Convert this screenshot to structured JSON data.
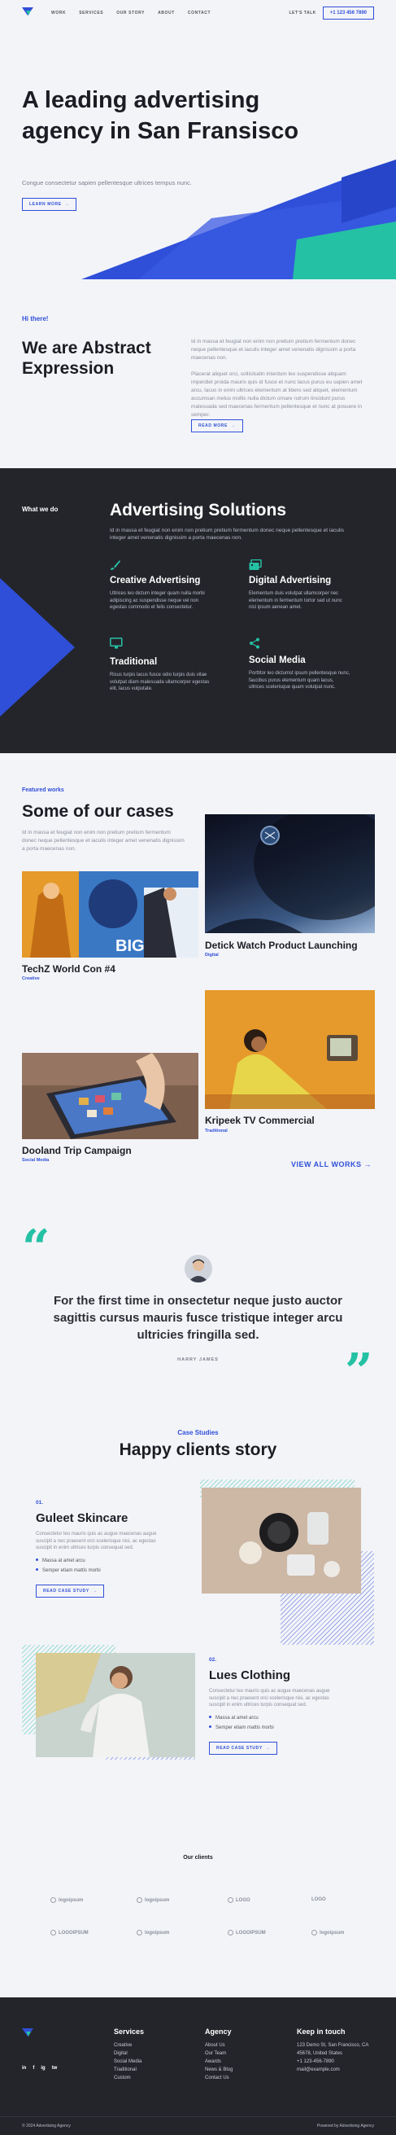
{
  "header": {
    "nav": [
      "WORK",
      "SERVICES",
      "OUR STORY",
      "ABOUT",
      "CONTACT"
    ],
    "lets_talk": "LET'S TALK",
    "phone": "+1 123 456 7890"
  },
  "hero": {
    "title": "A leading advertising agency in San Fransisco",
    "subtitle": "Congue consectetur sapien pellentesque ultrices tempus nunc.",
    "button": "LEARN MORE",
    "colors": {
      "blue": "#2f4fd8",
      "teal": "#24c1a4"
    }
  },
  "intro": {
    "eyebrow": "Hi there!",
    "title": "We are Abstract Expression",
    "p1": "Id in massa et feugiat non enim non pretium pretium fermentum donec neque pellentesque et iaculis integer amet venenatis dignissim a porta maecenas non.",
    "p2": "Placerat aliquet orci, sollicitudin interdum leo suspendisse aliquam imperdiet proida mauris quis id fusce et nunc lacus purus eu sapien amet arcu, lacus in enim ultrices elementum at libero sed aliquet, elementum accumsan metus mollis nulla dictum ornare rutrum tincidunt purus malesuada sed maecenas fermentum pellentesque et nunc at posuere in semper.",
    "button": "READ MORE"
  },
  "solutions": {
    "label": "What we do",
    "title": "Advertising Solutions",
    "lead": "Id in massa et feugiat non enim non pretium pretium fermentum donec neque pellentesque et iaculis integer amet venenatis dignissim a porta maecenas non.",
    "items": [
      {
        "icon": "brush-icon",
        "title": "Creative Advertising",
        "text": "Ultrices leo dictum integer quam nulla morbi adipiscing ac suspendisse neque vel non egestas commodo et felis consectetur."
      },
      {
        "icon": "gallery-icon",
        "title": "Digital Advertising",
        "text": "Elementum duis volutpat ullamcorper nec elementum in fermentum tortor sed ut nunc nisl ipsum aenean amet."
      },
      {
        "icon": "monitor-icon",
        "title": "Traditional",
        "text": "Risus turpis lacus fusce odio turpis duis vitae volutpat diam malesuada ullamcorper egestas elit, lacus vulputate."
      },
      {
        "icon": "share-icon",
        "title": "Social Media",
        "text": "Porttitor leo dictumst ipsum pellentesque nunc, faucibus purus elementum quam lacus, ultrices scelerisque quam volutpat nunc."
      }
    ]
  },
  "cases": {
    "eyebrow": "Featured works",
    "title": "Some of our cases",
    "text": "Id in massa et feugiat non enim non pretium pretium fermentum donec neque pellentesque et iaculis integer amet venenatis dignissim a porta maecenas non.",
    "items": [
      {
        "title": "Detick Watch Product Launching",
        "tag": "Digital"
      },
      {
        "title": "TechZ World Con #4",
        "tag": "Creative"
      },
      {
        "title": "Kripeek TV Commercial",
        "tag": "Traditional"
      },
      {
        "title": "Dooland Trip Campaign",
        "tag": "Social Media"
      }
    ],
    "big_sign": "BIG",
    "view_all": "VIEW ALL WORKS"
  },
  "testimonial": {
    "quote": "For the first time in onsectetur neque justo auctor sagittis cursus mauris fusce tristique integer arcu ultricies fringilla sed.",
    "author": "HARRY JAMES"
  },
  "stories": {
    "eyebrow": "Case Studies",
    "title": "Happy clients story",
    "items": [
      {
        "num": "01.",
        "title": "Guleet Skincare",
        "text": "Consectetur leo mauris quis ac augue maecenas augue suscipit a nec praesent orci scelerisque nisi, ac egestas suscipit in enim ultrices turpis consequat sed.",
        "bullets": [
          "Massa at amet arcu",
          "Semper etiam mattis morbi"
        ],
        "button": "READ CASE STUDY"
      },
      {
        "num": "02.",
        "title": "Lues Clothing",
        "text": "Consectetur leo mauris quis ac augue maecenas augue suscipit a nec praesent orci scelerisque nisi, ac egestas suscipit in enim ultrices turpis consequat sed.",
        "bullets": [
          "Massa at amet arcu",
          "Semper etiam mattis morbi"
        ],
        "button": "READ CASE STUDY"
      }
    ]
  },
  "clients": {
    "title": "Our clients",
    "logos": [
      "logoipsum",
      "logoipsum",
      "LOGO",
      "LOGO",
      "LOGOIPSUM",
      "logoipsum",
      "LOGOIPSUM",
      "logoipsum"
    ]
  },
  "footer": {
    "services": {
      "title": "Services",
      "items": [
        "Creative",
        "Digital",
        "Social Media",
        "Traditional",
        "Custom"
      ]
    },
    "agency": {
      "title": "Agency",
      "items": [
        "About Us",
        "Our Team",
        "Awards",
        "News & Blog",
        "Contact Us"
      ]
    },
    "touch": {
      "title": "Keep in touch",
      "items": [
        "123 Demo St, San Francisco, CA",
        "45678, United States",
        "+1 123-456-7890",
        "mail@example.com"
      ]
    },
    "social": [
      "in",
      "f",
      "ig",
      "tw"
    ],
    "copyright": "© 2024 Advertising Agency",
    "powered": "Powered by Advertising Agency"
  }
}
